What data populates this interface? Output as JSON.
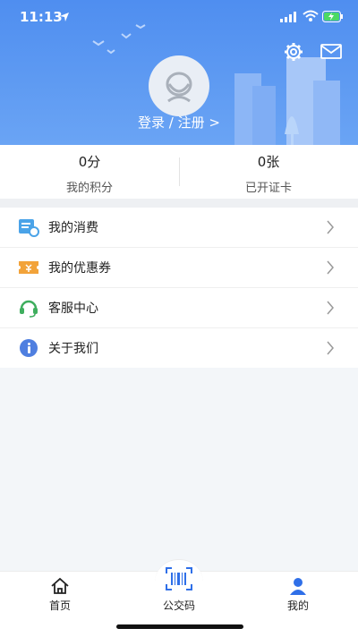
{
  "status_bar": {
    "time": "11:13"
  },
  "profile": {
    "login_text": "登录 / 注册 >"
  },
  "stats": [
    {
      "value": "0分",
      "label": "我的积分"
    },
    {
      "value": "0张",
      "label": "已开证卡"
    }
  ],
  "menu": [
    {
      "label": "我的消费",
      "icon": "receipt-icon",
      "color": "#4aa3e8"
    },
    {
      "label": "我的优惠券",
      "icon": "coupon-icon",
      "color": "#f2a33a"
    },
    {
      "label": "客服中心",
      "icon": "headset-icon",
      "color": "#3fae5e"
    },
    {
      "label": "关于我们",
      "icon": "info-icon",
      "color": "#4f7fe0"
    }
  ],
  "tabbar": [
    {
      "label": "首页",
      "icon": "home-icon"
    },
    {
      "label": "公交码",
      "icon": "barcode-scan-icon"
    },
    {
      "label": "我的",
      "icon": "user-icon",
      "color": "#2f6fe8"
    }
  ],
  "colors": {
    "header_top": "#4f8ef0",
    "header_bottom": "#6aa4f4",
    "accent": "#2f6fe8"
  }
}
